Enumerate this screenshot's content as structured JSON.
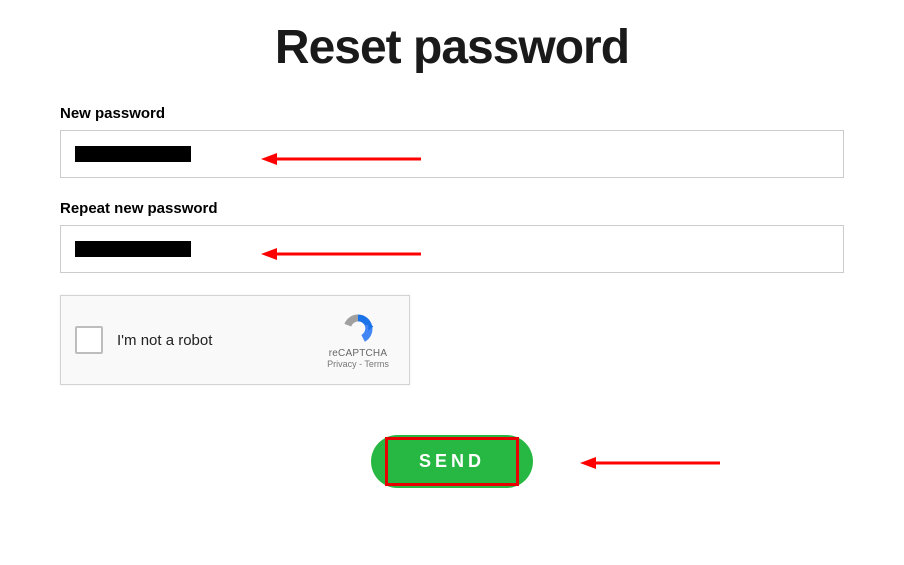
{
  "title": "Reset password",
  "fields": {
    "new_password": {
      "label": "New password",
      "value": ""
    },
    "repeat_password": {
      "label": "Repeat new password",
      "value": ""
    }
  },
  "recaptcha": {
    "label": "I'm not a robot",
    "brand": "reCAPTCHA",
    "links": "Privacy - Terms"
  },
  "button": {
    "send": "SEND"
  },
  "annotations": {
    "arrow_color": "#ff0000",
    "highlight_color": "#e60000"
  }
}
